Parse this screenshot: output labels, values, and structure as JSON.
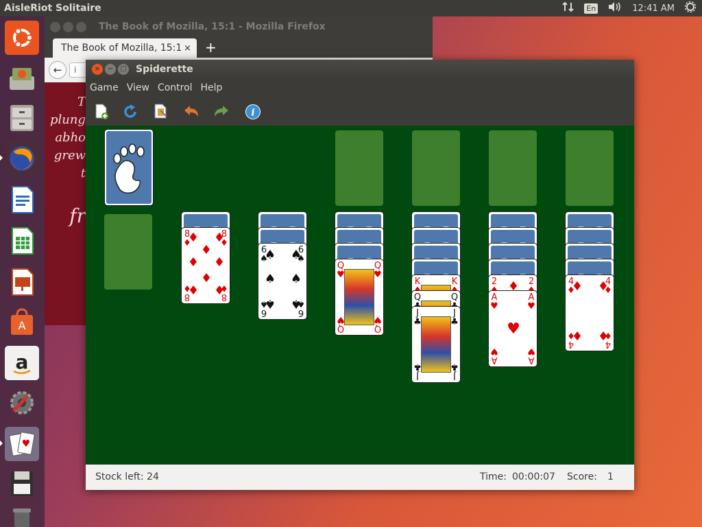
{
  "top_panel": {
    "app_title": "AisleRiot Solitaire",
    "keyboard_layout": "En",
    "clock": "12:41 AM",
    "icons": [
      "network-arrows-icon",
      "keyboard-layout-icon",
      "volume-icon",
      "power-icon"
    ]
  },
  "launcher": {
    "items": [
      {
        "name": "ubuntu-dash",
        "icon": "ubuntu-logo-icon",
        "color": "#e95420"
      },
      {
        "name": "install-ubuntu",
        "icon": "installer-icon",
        "color": "#8aa35a"
      },
      {
        "name": "files",
        "icon": "file-cabinet-icon",
        "color": "#9a9690"
      },
      {
        "name": "firefox",
        "icon": "firefox-icon",
        "color": "#e66000"
      },
      {
        "name": "libreoffice-writer",
        "icon": "writer-document-icon",
        "color": "#2a6ebb"
      },
      {
        "name": "libreoffice-calc",
        "icon": "calc-spreadsheet-icon",
        "color": "#2e9e3a"
      },
      {
        "name": "libreoffice-impress",
        "icon": "impress-presentation-icon",
        "color": "#c2461b"
      },
      {
        "name": "ubuntu-software",
        "icon": "software-bag-icon",
        "color": "#e9622b"
      },
      {
        "name": "amazon",
        "icon": "amazon-icon",
        "color": "#f2f1f0"
      },
      {
        "name": "system-settings",
        "icon": "settings-tools-icon",
        "color": "#7a7a7a"
      },
      {
        "name": "aisleriot",
        "icon": "playing-cards-icon",
        "color": "#6a6a9a"
      },
      {
        "name": "save-drive",
        "icon": "floppy-disk-icon",
        "color": "#404040"
      },
      {
        "name": "trash",
        "icon": "trash-icon",
        "color": "#555555"
      }
    ]
  },
  "firefox": {
    "window_title": "The Book of Mozilla, 15:1 - Mozilla Firefox",
    "tab_title": "The Book of Mozilla, 15:1",
    "tab_close": "×",
    "new_tab": "+",
    "back": "←",
    "url_prefix": "i",
    "content_lines": [
      "T",
      "plung",
      "abho",
      "grew",
      "t",
      "fr"
    ]
  },
  "game": {
    "window_title": "Spiderette",
    "close": "×",
    "minimize": "−",
    "maximize": "□",
    "menu": [
      "Game",
      "View",
      "Control",
      "Help"
    ],
    "toolbar": [
      {
        "name": "new-game",
        "icon": "new-game-icon"
      },
      {
        "name": "restart",
        "icon": "restart-icon"
      },
      {
        "name": "select-game",
        "icon": "select-game-icon"
      },
      {
        "name": "undo",
        "icon": "undo-icon"
      },
      {
        "name": "redo",
        "icon": "redo-icon"
      },
      {
        "name": "hint",
        "icon": "info-hint-icon"
      }
    ],
    "felt_color": "#004a0f",
    "stock_back": "gnome-foot-icon",
    "tableau": [
      {
        "backs": 0,
        "face": []
      },
      {
        "backs": 1,
        "face": [
          {
            "rank": "8",
            "suit": "♦",
            "color": "red"
          }
        ]
      },
      {
        "backs": 2,
        "face": [
          {
            "rank": "6",
            "suit": "♠",
            "color": "black"
          }
        ]
      },
      {
        "backs": 3,
        "face": [
          {
            "rank": "Q",
            "suit": "♥",
            "color": "red"
          }
        ]
      },
      {
        "backs": 4,
        "face": [
          {
            "rank": "K",
            "suit": "♦",
            "color": "red"
          },
          {
            "rank": "Q",
            "suit": "♣",
            "color": "black"
          },
          {
            "rank": "J",
            "suit": "♣",
            "color": "black"
          }
        ]
      },
      {
        "backs": 4,
        "face": [
          {
            "rank": "2",
            "suit": "♦",
            "color": "red"
          },
          {
            "rank": "A",
            "suit": "♥",
            "color": "red"
          }
        ]
      },
      {
        "backs": 4,
        "face": [
          {
            "rank": "4",
            "suit": "♦",
            "color": "red"
          }
        ]
      }
    ],
    "status": {
      "stock": "Stock left: 24",
      "time_label": "Time:",
      "time": "00:00:07",
      "score_label": "Score:",
      "score": "1"
    }
  }
}
